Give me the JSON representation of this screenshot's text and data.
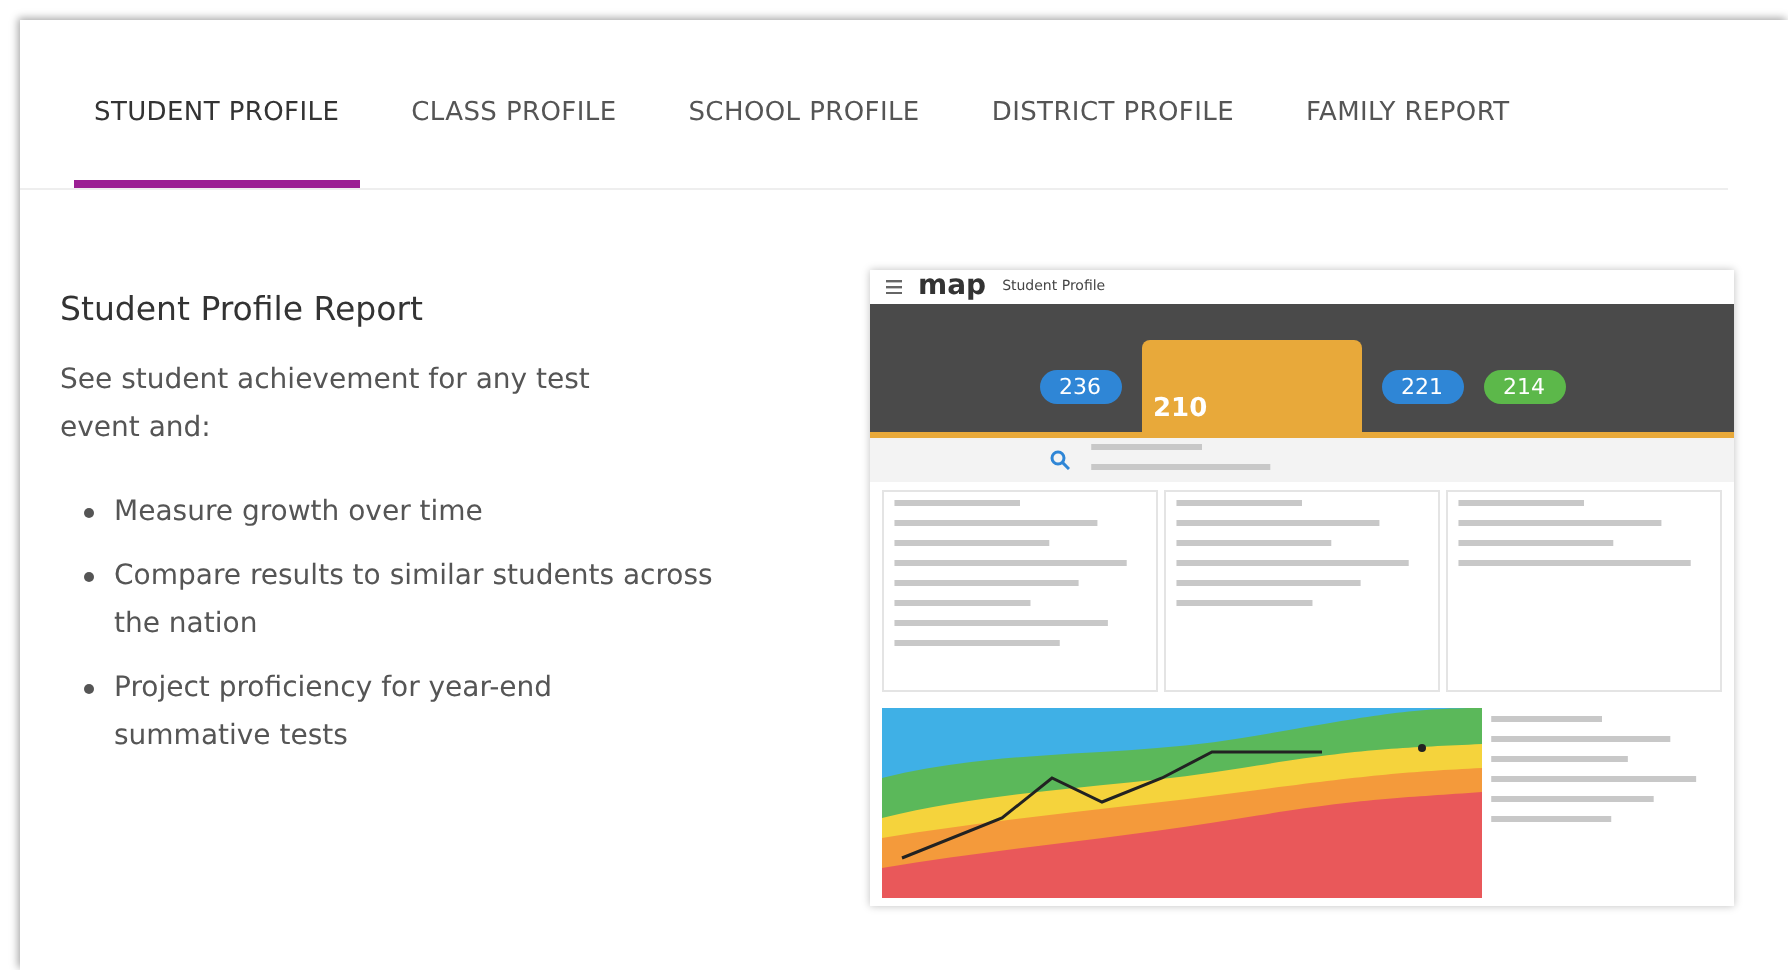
{
  "tabs": [
    {
      "label": "STUDENT PROFILE",
      "selected": true
    },
    {
      "label": "CLASS PROFILE",
      "selected": false
    },
    {
      "label": "SCHOOL PROFILE",
      "selected": false
    },
    {
      "label": "DISTRICT PROFILE",
      "selected": false
    },
    {
      "label": "FAMILY REPORT",
      "selected": false
    }
  ],
  "report": {
    "heading": "Student Profile Report",
    "intro": "See student achievement for any test event and:",
    "bullets": [
      "Measure growth over time",
      "Compare results to similar students across the nation",
      "Project proficiency for year-end summative tests"
    ]
  },
  "preview": {
    "logo": "map",
    "title": "Student Profile",
    "scores": [
      {
        "value": "236",
        "kind": "pill",
        "color": "#2f86d6"
      },
      {
        "value": "210",
        "kind": "card",
        "color": "#e8a93a"
      },
      {
        "value": "221",
        "kind": "pill",
        "color": "#2f86d6"
      },
      {
        "value": "214",
        "kind": "pill",
        "color": "#5cb84a"
      }
    ]
  }
}
